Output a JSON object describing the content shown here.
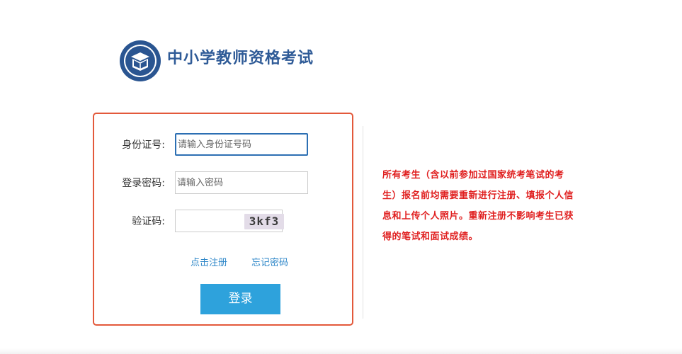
{
  "header": {
    "site_title": "中小学教师资格考试",
    "logo_icon": "teacher-exam-seal-logo"
  },
  "login_form": {
    "id_label": "身份证号:",
    "id_placeholder": "请输入身份证号码",
    "password_label": "登录密码:",
    "password_placeholder": "请输入密码",
    "captcha_label": "验证码:",
    "captcha_value": "",
    "captcha_image_text": "3kf3",
    "register_link": "点击注册",
    "forgot_link": "忘记密码",
    "login_button": "登录"
  },
  "notice": {
    "text": "所有考生（含以前参加过国家统考笔试的考生）报名前均需要重新进行注册、填报个人信息和上传个人照片。重新注册不影响考生已获得的笔试和面试成绩。"
  },
  "colors": {
    "panel_border": "#e3593b",
    "focused_input_border": "#2c6fb3",
    "link": "#2c86c8",
    "button": "#2ea2dc",
    "notice_text": "#e01f1f",
    "title": "#2f5b97"
  }
}
